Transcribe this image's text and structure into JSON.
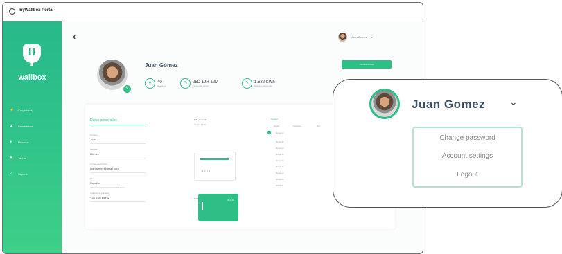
{
  "app_title": "myWallbox Portal",
  "sidebar": {
    "brand": "wallbox",
    "items": [
      {
        "label": "Cargadores",
        "icon": "charger-icon"
      },
      {
        "label": "Estadísticas",
        "icon": "statistics-icon"
      },
      {
        "label": "Usuarios",
        "icon": "users-icon"
      },
      {
        "label": "Tareas",
        "icon": "tasks-icon"
      },
      {
        "label": "Soporte",
        "icon": "support-icon"
      }
    ]
  },
  "header": {
    "back_icon": "back-arrow-icon",
    "user_name": "Juan Gomez",
    "green_button": "Cambiar estado"
  },
  "profile": {
    "name": "Juan Gómez",
    "stats": [
      {
        "value": "40",
        "label": "Sesiones"
      },
      {
        "value": "25D 19H 12M",
        "label": "Tiempo de carga"
      },
      {
        "value": "1.632 KWh",
        "label": "Energía consumida"
      }
    ]
  },
  "personal_data": {
    "title": "Datos personales",
    "fields": [
      {
        "label": "Nombre",
        "value": "Juan"
      },
      {
        "label": "Apellido",
        "value": "Gómez"
      },
      {
        "label": "Correo electrónico",
        "value": "juangomez@gmail.com"
      },
      {
        "label": "País",
        "value": "España"
      },
      {
        "label": "Teléfono de contacto",
        "value": "+34   638765432"
      }
    ]
  },
  "charger_section": {
    "title": "PIN personal",
    "subtitle": "Tarjeta RFID",
    "pin": "1  2  3  4",
    "balance_title": "Saldo",
    "card_value": "00,00"
  },
  "groups": {
    "title": "Grupos",
    "column_headers": [
      "Grupo",
      "Usuarios",
      "Rol"
    ],
    "rows": [
      "Grupo A",
      "Grupo B",
      "Grupo C",
      "Grupo D",
      "Grupo E",
      "Grupo F",
      "Grupo G",
      "Grupo H",
      "Grupo I"
    ]
  },
  "popup": {
    "user_name": "Juan Gomez",
    "menu": [
      "Change password",
      "Account settings",
      "Logout"
    ]
  }
}
